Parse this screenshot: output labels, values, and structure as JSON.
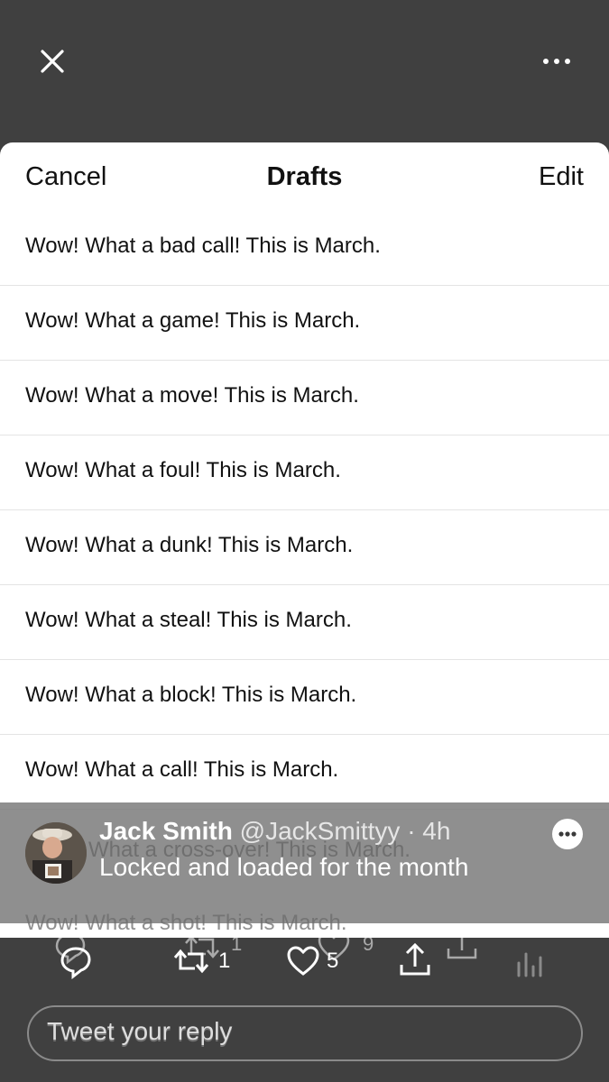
{
  "header": {
    "close_icon": "close-icon",
    "more_icon": "more-horizontal-icon"
  },
  "drafts_sheet": {
    "cancel_label": "Cancel",
    "title": "Drafts",
    "edit_label": "Edit",
    "items": [
      "Wow! What a bad call! This is March.",
      "Wow! What a game! This is March.",
      "Wow! What a move! This is March.",
      "Wow! What a foul! This is March.",
      "Wow! What a dunk! This is March.",
      "Wow! What a steal! This is March.",
      "Wow! What a block! This is March.",
      "Wow! What a call! This is March."
    ],
    "obscured_items": [
      "What a cross-over! This is March.",
      "Wow! What a shot! This is March."
    ]
  },
  "tweet": {
    "display_name": "Jack Smith",
    "handle_time": "@JackSmittyy · 4h",
    "text": "Locked and loaded for the month"
  },
  "actions": {
    "reply_icon": "reply-icon",
    "retweet_icon": "retweet-icon",
    "retweet_count": "1",
    "like_icon": "heart-icon",
    "like_count": "5",
    "share_icon": "share-icon",
    "analytics_icon": "analytics-icon",
    "ghost_retweet_count": "1",
    "ghost_like_count": "9"
  },
  "reply": {
    "placeholder": "Tweet your reply"
  },
  "colors": {
    "background": "#404040",
    "sheet": "#ffffff",
    "overlay": "#767676",
    "text": "#111111"
  }
}
